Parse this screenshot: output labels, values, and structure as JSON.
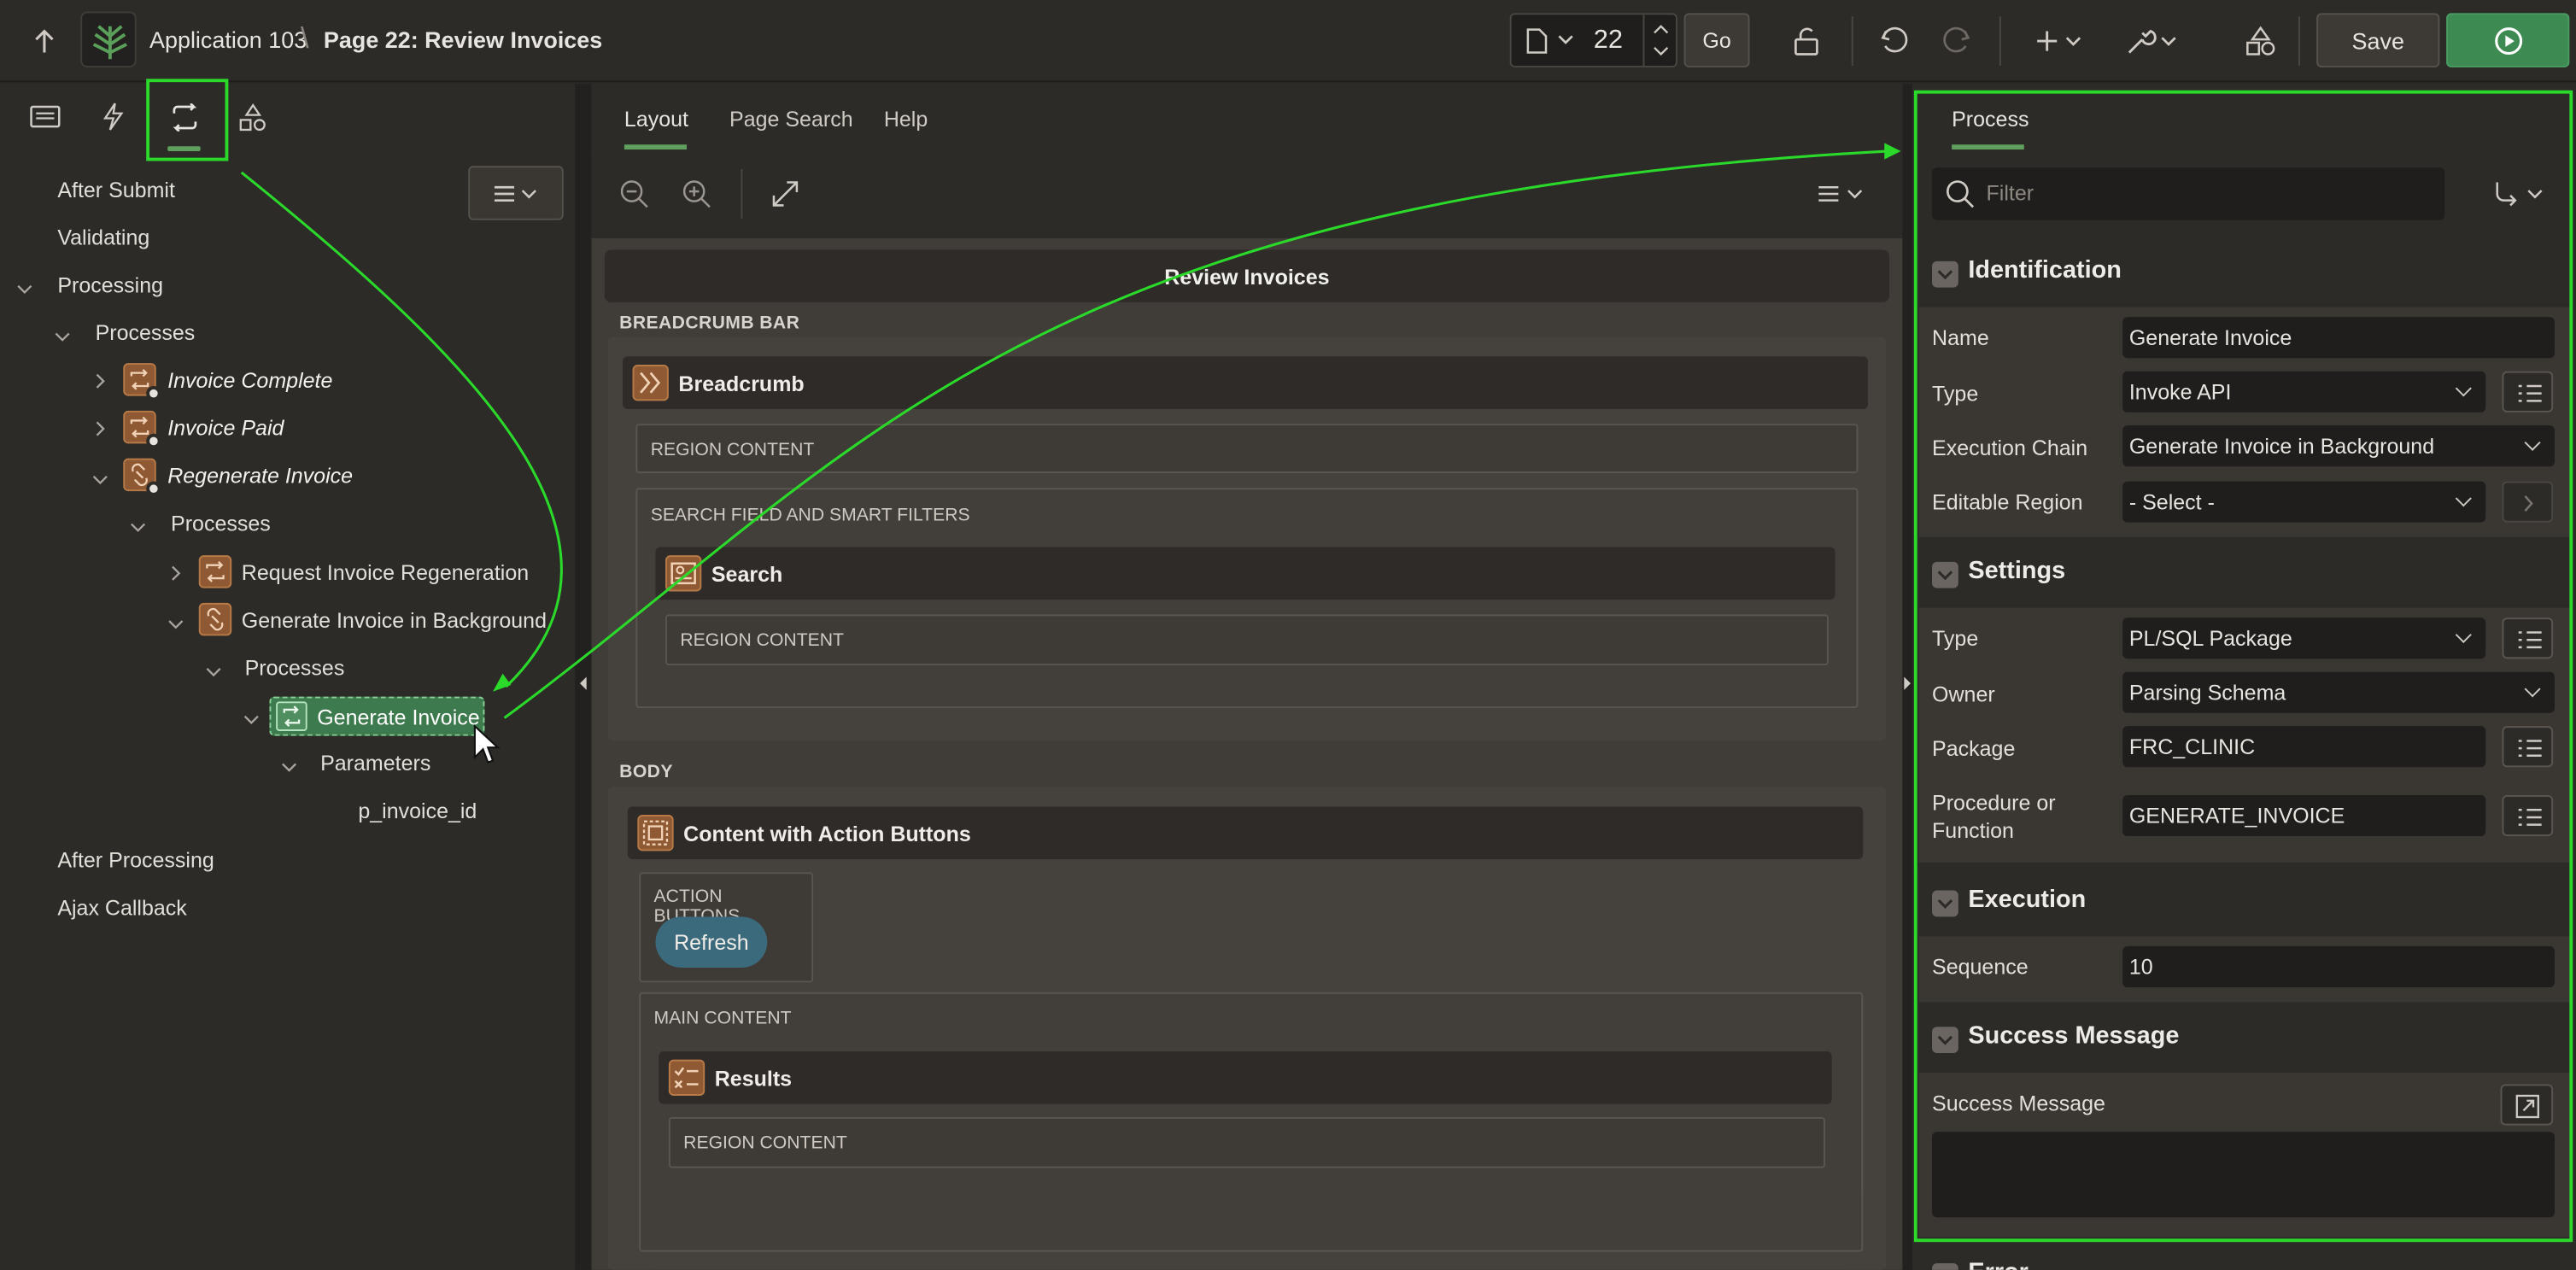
{
  "header": {
    "app": "Application 103",
    "separator": "\\",
    "page": "Page 22: Review Invoices",
    "page_number": "22",
    "go": "Go",
    "save": "Save"
  },
  "left_tree": {
    "after_submit": "After Submit",
    "validating": "Validating",
    "processing": "Processing",
    "processes": "Processes",
    "invoice_complete": "Invoice Complete",
    "invoice_paid": "Invoice Paid",
    "regenerate_invoice": "Regenerate Invoice",
    "processes2": "Processes",
    "request_regen": "Request Invoice Regeneration",
    "gen_bg": "Generate Invoice in Background",
    "processes3": "Processes",
    "gen_invoice": "Generate Invoice",
    "parameters": "Parameters",
    "p_invoice_id": "p_invoice_id",
    "after_processing": "After Processing",
    "ajax_callback": "Ajax Callback"
  },
  "center": {
    "tabs": {
      "layout": "Layout",
      "page_search": "Page Search",
      "help": "Help"
    },
    "page_title": "Review Invoices",
    "breadcrumb_bar": "BREADCRUMB BAR",
    "breadcrumb": "Breadcrumb",
    "region_content1": "REGION CONTENT",
    "search_filters": "SEARCH FIELD AND SMART FILTERS",
    "search": "Search",
    "region_content2": "REGION CONTENT",
    "body": "BODY",
    "content_action": "Content with Action Buttons",
    "action_buttons": "ACTION BUTTONS",
    "refresh": "Refresh",
    "main_content": "MAIN CONTENT",
    "results": "Results",
    "region_content3": "REGION CONTENT"
  },
  "right": {
    "tab": "Process",
    "filter_placeholder": "Filter",
    "identification": "Identification",
    "name_label": "Name",
    "name_value": "Generate Invoice",
    "type_label": "Type",
    "type_value": "Invoke API",
    "exec_chain_label": "Execution Chain",
    "exec_chain_value": "Generate Invoice in Background",
    "editable_label": "Editable Region",
    "editable_value": "- Select -",
    "settings": "Settings",
    "stype_label": "Type",
    "stype_value": "PL/SQL Package",
    "owner_label": "Owner",
    "owner_value": "Parsing Schema",
    "package_label": "Package",
    "package_value": "FRC_CLINIC",
    "proc_label1": "Procedure or",
    "proc_label2": "Function",
    "proc_value": "GENERATE_INVOICE",
    "execution": "Execution",
    "sequence_label": "Sequence",
    "sequence_value": "10",
    "success_message": "Success Message",
    "success_label": "Success Message",
    "error": "Error"
  },
  "colors": {
    "accent": "#3e8a53",
    "highlight": "#2bd92b",
    "process_icon": "#8f5a33"
  }
}
